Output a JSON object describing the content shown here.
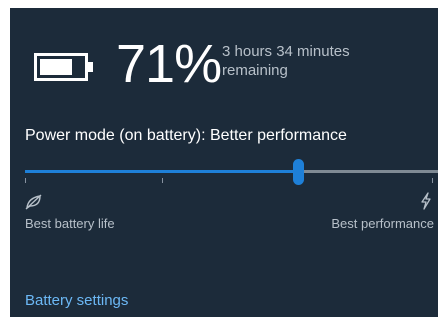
{
  "battery": {
    "percent": "71%",
    "remaining_line1": "3 hours 34 minutes",
    "remaining_line2": "remaining",
    "charge_level": 0.71,
    "icon": "battery-icon"
  },
  "power_mode": {
    "label": "Power mode (on battery): Better performance",
    "slider_value": 0.66,
    "left_icon": "battery-saver-icon",
    "right_icon": "lightning-bolt-icon",
    "left_caption": "Best battery life",
    "right_caption": "Best performance"
  },
  "links": {
    "battery_settings": "Battery settings"
  },
  "colors": {
    "background": "#1c2b3a",
    "accent": "#1e80d8",
    "link": "#6cb8f5",
    "secondary_text": "#b7c0c9"
  }
}
